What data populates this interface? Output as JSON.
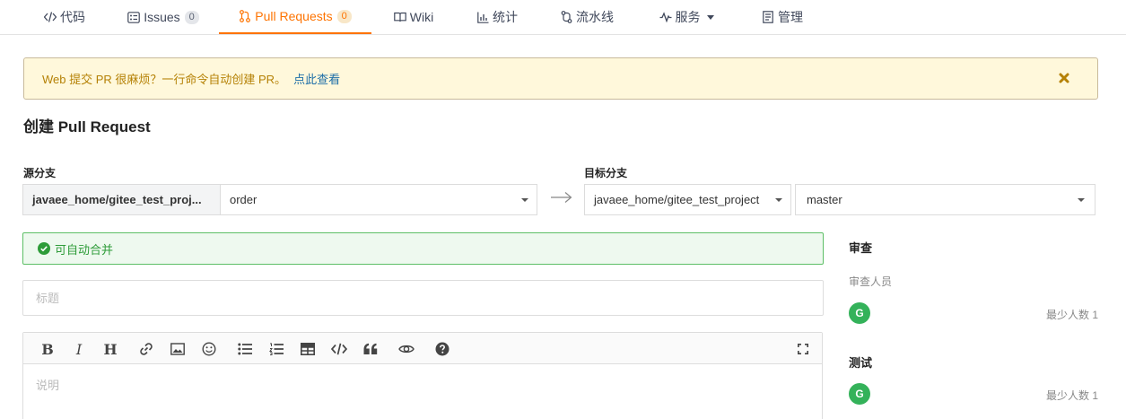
{
  "nav": {
    "tabs": [
      {
        "label": "代码",
        "icon": "code-icon"
      },
      {
        "label": "Issues",
        "badge": "0",
        "icon": "issues-icon"
      },
      {
        "label": "Pull Requests",
        "badge": "0",
        "icon": "pull-request-icon",
        "active": true
      },
      {
        "label": "Wiki",
        "icon": "book-icon"
      },
      {
        "label": "统计",
        "icon": "bar-chart-icon"
      },
      {
        "label": "流水线",
        "icon": "pipeline-icon"
      },
      {
        "label": "服务",
        "icon": "pulse-icon"
      },
      {
        "label": "管理",
        "icon": "settings-doc-icon"
      }
    ]
  },
  "banner": {
    "text": "Web 提交 PR 很麻烦？一行命令自动创建 PR。",
    "link": "点此查看"
  },
  "page": {
    "title": "创建 Pull Request"
  },
  "source": {
    "label": "源分支",
    "repo": "javaee_home/gitee_test_proj...",
    "branch": "order"
  },
  "target": {
    "label": "目标分支",
    "repo": "javaee_home/gitee_test_project",
    "branch": "master"
  },
  "merge_status": "可自动合并",
  "form": {
    "title_placeholder": "标题",
    "desc_placeholder": "说明"
  },
  "editor_toolbar": [
    "bold-icon",
    "italic-icon",
    "heading-icon",
    "link-icon",
    "image-icon",
    "emoji-icon",
    "unordered-list-icon",
    "ordered-list-icon",
    "table-icon",
    "code-icon",
    "quote-icon",
    "preview-eye-icon",
    "help-icon",
    "fullscreen-icon"
  ],
  "sidebar": {
    "review_heading": "审查",
    "reviewers_label": "审查人员",
    "reviewer_avatar": "G",
    "reviewer_min": "最少人数 1",
    "test_heading": "测试",
    "tester_avatar": "G",
    "tester_min": "最少人数 1"
  },
  "colors": {
    "accent": "#fe7300",
    "success": "#2e9c39",
    "warning_bg": "#fff8db",
    "avatar": "#34b25a"
  }
}
